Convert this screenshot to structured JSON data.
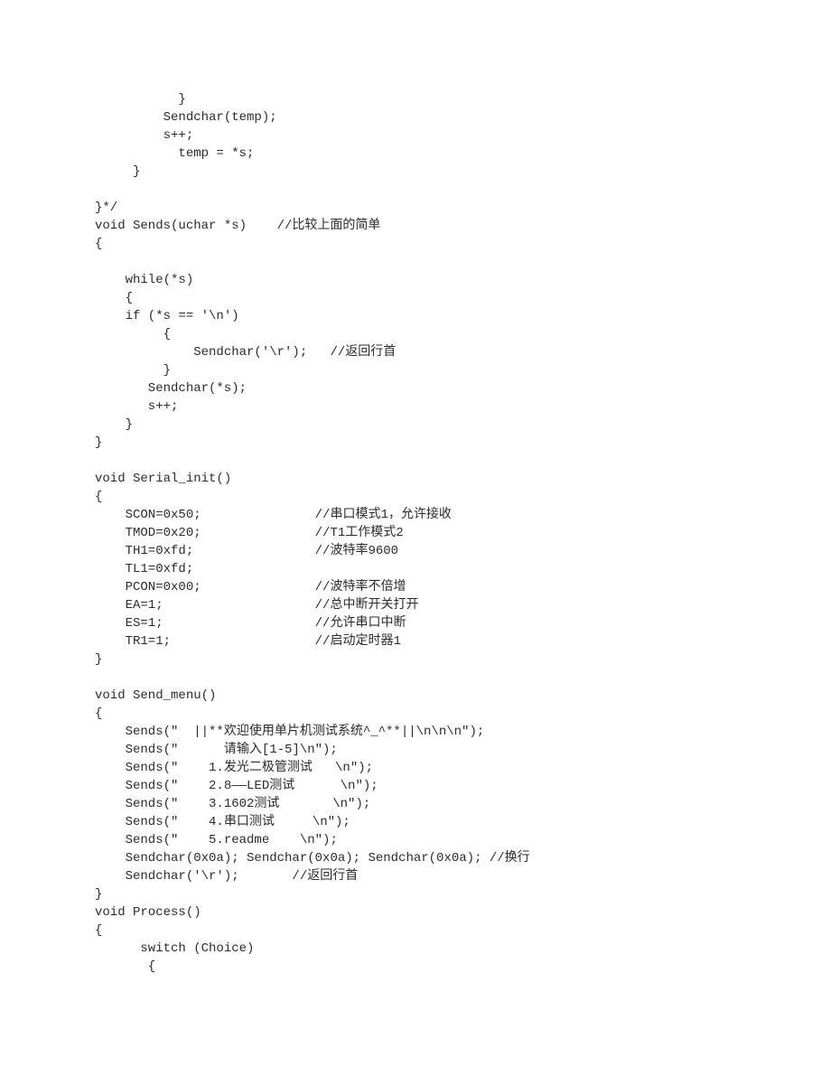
{
  "code": {
    "lines": [
      "           }",
      "         Sendchar(temp);",
      "         s++;",
      "           temp = *s;",
      "     }",
      "",
      "}*/",
      "void Sends(uchar *s)    //比较上面的简单",
      "{",
      "",
      "    while(*s)",
      "    {",
      "    if (*s == '\\n')",
      "         {",
      "             Sendchar('\\r');   //返回行首",
      "         }",
      "       Sendchar(*s);",
      "       s++;",
      "    }",
      "}",
      "",
      "void Serial_init()",
      "{",
      "    SCON=0x50;               //串口模式1，允许接收",
      "    TMOD=0x20;               //T1工作模式2",
      "    TH1=0xfd;                //波特率9600",
      "    TL1=0xfd;",
      "    PCON=0x00;               //波特率不倍增",
      "    EA=1;                    //总中断开关打开",
      "    ES=1;                    //允许串口中断",
      "    TR1=1;                   //启动定时器1",
      "}",
      "",
      "void Send_menu()",
      "{",
      "    Sends(\"  ||**欢迎使用单片机测试系统^_^**||\\n\\n\\n\");",
      "    Sends(\"      请输入[1-5]\\n\");",
      "    Sends(\"    1.发光二极管测试   \\n\");",
      "    Sends(\"    2.8——LED测试      \\n\");",
      "    Sends(\"    3.1602测试       \\n\");",
      "    Sends(\"    4.串口测试     \\n\");",
      "    Sends(\"    5.readme    \\n\");",
      "    Sendchar(0x0a); Sendchar(0x0a); Sendchar(0x0a); //换行",
      "    Sendchar('\\r');       //返回行首",
      "}",
      "void Process()",
      "{",
      "      switch (Choice)",
      "       {"
    ]
  }
}
